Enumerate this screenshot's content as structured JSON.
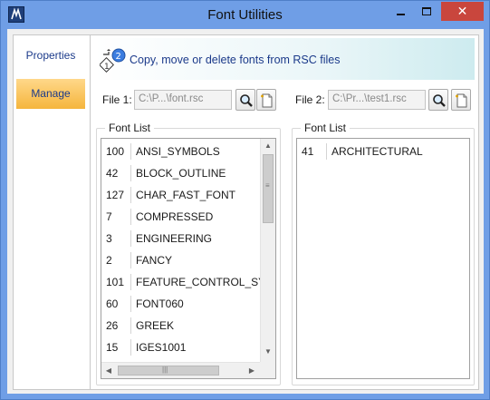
{
  "window": {
    "title": "Font Utilities"
  },
  "sidebar": {
    "items": [
      {
        "label": "Properties",
        "selected": false
      },
      {
        "label": "Manage",
        "selected": true
      }
    ]
  },
  "banner": {
    "text": "Copy, move or delete fonts from RSC files",
    "icon": "copy-fonts-icon"
  },
  "file1": {
    "label": "File 1:",
    "value": "C:\\P...\\font.rsc"
  },
  "file2": {
    "label": "File 2:",
    "value": "C:\\Pr...\\test1.rsc"
  },
  "left_list": {
    "title": "Font List",
    "rows": [
      {
        "num": "100",
        "name": "ANSI_SYMBOLS"
      },
      {
        "num": "42",
        "name": "BLOCK_OUTLINE"
      },
      {
        "num": "127",
        "name": "CHAR_FAST_FONT"
      },
      {
        "num": "7",
        "name": "COMPRESSED"
      },
      {
        "num": "3",
        "name": "ENGINEERING"
      },
      {
        "num": "2",
        "name": "FANCY"
      },
      {
        "num": "101",
        "name": "FEATURE_CONTROL_SYM"
      },
      {
        "num": "60",
        "name": "FONT060"
      },
      {
        "num": "26",
        "name": "GREEK"
      },
      {
        "num": "15",
        "name": "IGES1001"
      }
    ]
  },
  "right_list": {
    "title": "Font List",
    "rows": [
      {
        "num": "41",
        "name": "ARCHITECTURAL"
      }
    ]
  },
  "colors": {
    "title_bar": "#6f9ee6",
    "close_button": "#c9463d",
    "selected_tab": "#f5b53c",
    "link_text": "#1b3a8a"
  },
  "icons": {
    "browse": "magnifier-icon",
    "new_file": "new-file-icon",
    "app": "microstation-icon"
  }
}
